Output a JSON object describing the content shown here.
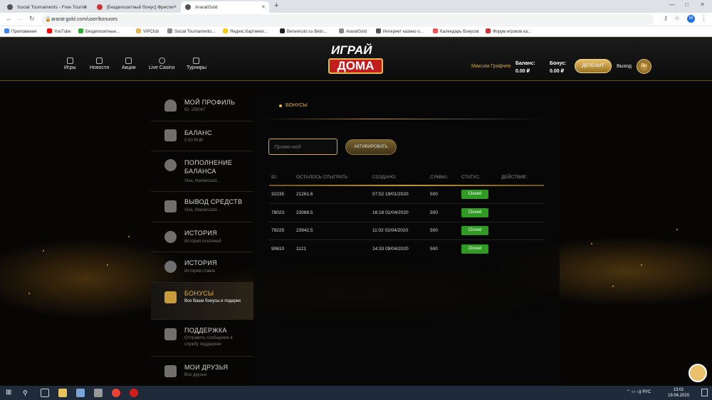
{
  "browser": {
    "tabs": [
      {
        "title": "Social Tournaments - Free Tourna"
      },
      {
        "title": "[Бездепозитный бонус] Фриспи"
      },
      {
        "title": "AraratGold"
      }
    ],
    "url": "ararat-gold.com/user/bonuses",
    "bookmarks": [
      "Приложения",
      "YouTube",
      "Бездепозитные...",
      "VIPClub",
      "Social Tournaments...",
      "Яндекс.Картинки:...",
      "Benvenuto su Betn...",
      "AraratGold",
      "Интернет казино о...",
      "Календарь бонусов",
      "Форум игроков ка..."
    ],
    "profile_initial": "M"
  },
  "header": {
    "nav": [
      {
        "label": "Игры"
      },
      {
        "label": "Новости"
      },
      {
        "label": "Акции"
      },
      {
        "label": "Live Casino"
      },
      {
        "label": "Турниры"
      }
    ],
    "logo_top": "ИГРАЙ",
    "logo_bottom": "ДОМА",
    "username": "Максим Графчев",
    "balance_label": "Баланс:",
    "balance_value": "0.00 ₽",
    "bonus_label": "Бонус:",
    "bonus_value": "0.00 ₽",
    "deposit_label": "ДЕПОЗИТ",
    "exit_label": "Выход",
    "lang_label": "Ru"
  },
  "sidebar": {
    "items": [
      {
        "title": "МОЙ ПРОФИЛЬ",
        "sub": "ID: 155047",
        "icon": "user-icon"
      },
      {
        "title": "БАЛАНС",
        "sub": "0.00 RUB",
        "icon": "wallet-icon"
      },
      {
        "title": "ПОПОЛНЕНИЕ БАЛАНСА",
        "sub": "Visa, Mastercard...",
        "icon": "dollar-icon"
      },
      {
        "title": "ВЫВОД СРЕДСТВ",
        "sub": "Visa, Mastercard...",
        "icon": "coins-icon"
      },
      {
        "title": "ИСТОРИЯ",
        "sub": "История платежей",
        "icon": "history-icon"
      },
      {
        "title": "ИСТОРИЯ",
        "sub": "История ставок",
        "icon": "history-icon"
      },
      {
        "title": "БОНУСЫ",
        "sub": "Все Ваши бонусы и подарки",
        "icon": "gift-icon",
        "active": true
      },
      {
        "title": "ПОДДЕРЖКА",
        "sub": "Отправить сообщение в службу поддержки",
        "icon": "chat-icon"
      },
      {
        "title": "МОИ ДРУЗЬЯ",
        "sub": "Все друзья",
        "icon": "gift-icon"
      }
    ]
  },
  "content": {
    "tab": "БОНУСЫ",
    "promo_placeholder": "Промо-код",
    "activate_label": "АКТИВИРОВАТЬ",
    "columns": [
      "ID:",
      "ОСТАЛОСЬ ОТЫГРАТЬ:",
      "СОЗДАНО:",
      "СУММА:",
      "СТАТУС:",
      "ДЕЙСТВИЕ:"
    ],
    "rows": [
      {
        "id": "32235",
        "remaining": "21261.6",
        "created": "07:52 19/01/2020",
        "amount": "500",
        "status": "Closed"
      },
      {
        "id": "78023",
        "remaining": "23088.5",
        "created": "16:18 01/04/2020",
        "amount": "500",
        "status": "Closed"
      },
      {
        "id": "79225",
        "remaining": "23942.5",
        "created": "11:02 02/04/2020",
        "amount": "500",
        "status": "Closed"
      },
      {
        "id": "90610",
        "remaining": "1121",
        "created": "14:33 09/04/2020",
        "amount": "500",
        "status": "Closed"
      }
    ]
  },
  "taskbar": {
    "lang": "РУС",
    "time": "13:01",
    "date": "19.04.2020"
  },
  "colors": {
    "accent": "#e6b14a",
    "status_closed": "#2f9b23",
    "logo_red": "#c31d1d"
  }
}
